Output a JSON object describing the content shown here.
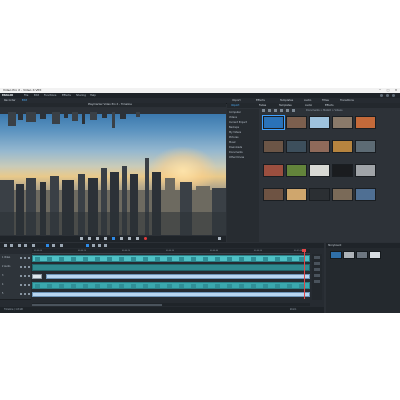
{
  "window": {
    "title": "Video Pro X - Video X.VPX",
    "controls": [
      "─",
      "□",
      "✕"
    ]
  },
  "menu": {
    "logo": "MAGIX",
    "items": [
      "File",
      "Edit",
      "Functions",
      "Effects",
      "Sharing",
      "Help"
    ]
  },
  "tabs": {
    "items": [
      "Recorder",
      "Edit",
      "Import",
      "Effects",
      "Templates",
      "Audio",
      "Titles",
      "Transitions"
    ],
    "active_index": 1
  },
  "preview": {
    "title": "Playmarker Video Pro X - Timeline"
  },
  "mediapool": {
    "headers": [
      "Import",
      "Fades",
      "Templates",
      "Audio",
      "Effects"
    ],
    "active_index": 0,
    "path": "Documents > MAGIX > Videos",
    "tree": [
      "Computer",
      "Videos",
      "Current Project",
      "Backups",
      "My Videos",
      "Pictures",
      "Music",
      "Downloads",
      "Documents",
      "Other Drives"
    ],
    "thumb_colors": [
      "#2a72b8",
      "#7c5f4e",
      "#9ec2dd",
      "#8a7a6a",
      "#c46a3a",
      "#6b5546",
      "#3d4f5c",
      "#8f6a5a",
      "#b6843f",
      "#5d6b74",
      "#9b4f3f",
      "#63843b",
      "#d8d9d4",
      "#1a1c1f",
      "#a0a4a8",
      "#6e5343",
      "#cfa66d",
      "#2b2f33",
      "#7a6a58",
      "#4f6f93"
    ]
  },
  "timeline": {
    "toolbar_label": "Timeline",
    "ruler": [
      "00:00:00",
      "00:00:10",
      "00:00:20",
      "00:00:30",
      "00:00:40",
      "00:00:50",
      "00:01:00"
    ],
    "tracks": [
      "1 Video",
      "2 Audio",
      "3",
      "4",
      "5",
      "6"
    ],
    "status_left": "Timeline / 1.8 GB",
    "status_right": "Zoom"
  },
  "storyboard": {
    "title": "Storyboard",
    "thumb_colors": [
      "#2f6fa8",
      "#aeb3b8",
      "#6d7680",
      "#d7dde2"
    ]
  },
  "colors": {
    "accent": "#2e8ae6",
    "clip": "#4ec0c4",
    "playhead": "#e04646",
    "background": "#2b3036"
  }
}
